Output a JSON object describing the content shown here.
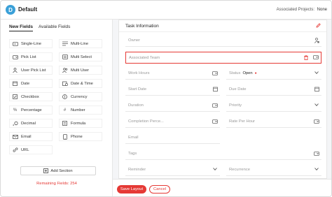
{
  "header": {
    "logo_letter": "D",
    "layout_name": "Default",
    "associated_projects_label": "Associated Projects:",
    "associated_projects_value": "None"
  },
  "left_panel": {
    "tabs": [
      {
        "label": "New Fields",
        "active": true
      },
      {
        "label": "Available Fields",
        "active": false
      }
    ],
    "fields": [
      {
        "label": "Single-Line",
        "icon": "single-line-icon"
      },
      {
        "label": "Multi-Line",
        "icon": "multi-line-icon"
      },
      {
        "label": "Pick List",
        "icon": "pick-list-icon"
      },
      {
        "label": "Multi Select",
        "icon": "multi-select-icon"
      },
      {
        "label": "User Pick List",
        "icon": "user-icon"
      },
      {
        "label": "Multi User",
        "icon": "multi-user-icon"
      },
      {
        "label": "Date",
        "icon": "calendar-icon"
      },
      {
        "label": "Date & Time",
        "icon": "calendar-clock-icon"
      },
      {
        "label": "Checkbox",
        "icon": "checkbox-icon"
      },
      {
        "label": "Currency",
        "icon": "currency-icon"
      },
      {
        "label": "Percentage",
        "icon": "percent-icon"
      },
      {
        "label": "Number",
        "icon": "hash-icon"
      },
      {
        "label": "Decimal",
        "icon": "decimal-icon"
      },
      {
        "label": "Formula",
        "icon": "formula-icon"
      },
      {
        "label": "Email",
        "icon": "email-icon"
      },
      {
        "label": "Phone",
        "icon": "phone-icon"
      },
      {
        "label": "URL",
        "icon": "link-icon"
      }
    ],
    "add_section_label": "Add Section",
    "remaining_fields_text": "Remaining Fields: 254"
  },
  "card": {
    "title": "Task Information",
    "rows": {
      "owner": "Owner",
      "associated_team": "Associated Team",
      "work_hours": "Work Hours",
      "status_label": "Status",
      "status_value": "Open",
      "start_date": "Start Date",
      "due_date": "Due Date",
      "duration": "Duration",
      "priority": "Priority",
      "completion": "Completion Perce...",
      "rate_per_hour": "Rate Per Hour",
      "email": "Email",
      "tags": "Tags",
      "reminder": "Reminder",
      "recurrence": "Recurrence"
    }
  },
  "footer": {
    "save_label": "Save Layout",
    "cancel_label": "Cancel"
  },
  "colors": {
    "accent": "#e53935",
    "logo": "#3aa0d8"
  }
}
